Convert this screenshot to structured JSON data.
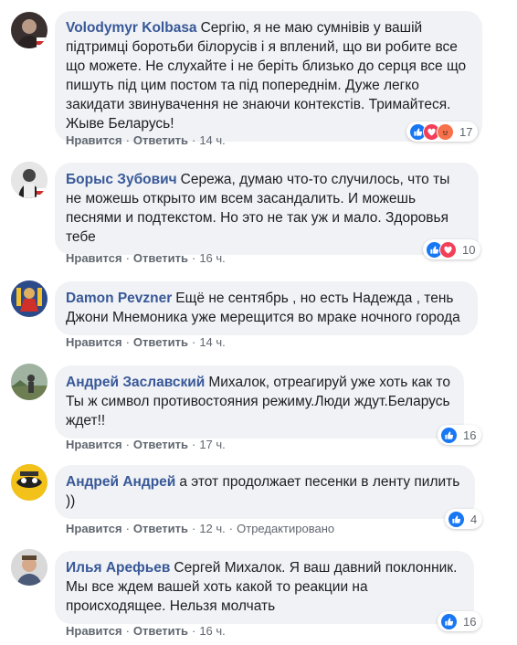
{
  "actions": {
    "like_label": "Нравится",
    "reply_label": "Ответить",
    "edited_label": "Отредактировано"
  },
  "colors": {
    "bubble_bg": "#f0f2f5",
    "author": "#385898",
    "meta": "#606770",
    "like": "#1877f2",
    "love": "#f33e58",
    "angry": "#f7714b"
  },
  "comments": [
    {
      "author": "Volodymyr Kolbasa",
      "text": "Сергію, я не маю сумнівів у вашій підтримці боротьби білорусів і я вплений, що ви робите все що можете. Не слухайте і не беріть близько до серця все що пишуть під цим постом та під попереднім. Дуже легко закидати звинувачення не знаючи контекстів. Тримайтеся. Жыве Беларусь!",
      "time": "14 ч.",
      "reactions": [
        "like-icon",
        "love-icon",
        "angry-icon"
      ],
      "reaction_count": "17"
    },
    {
      "author": "Борыс Зубович",
      "text": "Сережа, думаю что-то случилось, что ты не можешь открыто им всем засандалить. И можешь песнями и подтекстом. Но это не так уж и мало. Здоровья тебе",
      "time": "16 ч.",
      "reactions": [
        "like-icon",
        "love-icon"
      ],
      "reaction_count": "10"
    },
    {
      "author": "Damon Pevzner",
      "text": "Ещё не сентябрь , но есть Надежда , тень Джони Мнемоника уже мерещится во мраке ночного города",
      "time": "14 ч.",
      "reactions": [],
      "reaction_count": ""
    },
    {
      "author": "Андрей Заславский",
      "text": "Михалок, отреагируй уже хоть как то Ты ж символ противостояния режиму.Люди ждут.Беларусь ждет!!",
      "time": "17 ч.",
      "reactions": [
        "like-icon"
      ],
      "reaction_count": "16"
    },
    {
      "author": "Андрей Андрей",
      "text": "а этот продолжает песенки в ленту пилить ))",
      "time": "12 ч.",
      "edited": true,
      "reactions": [
        "like-icon"
      ],
      "reaction_count": "4"
    },
    {
      "author": "Илья Арефьев",
      "text": "Сергей Михалок. Я ваш давний поклонник. Мы все ждем вашей хоть какой то реакции на происходящее. Нельзя молчать",
      "time": "16 ч.",
      "reactions": [
        "like-icon"
      ],
      "reaction_count": "16"
    }
  ]
}
